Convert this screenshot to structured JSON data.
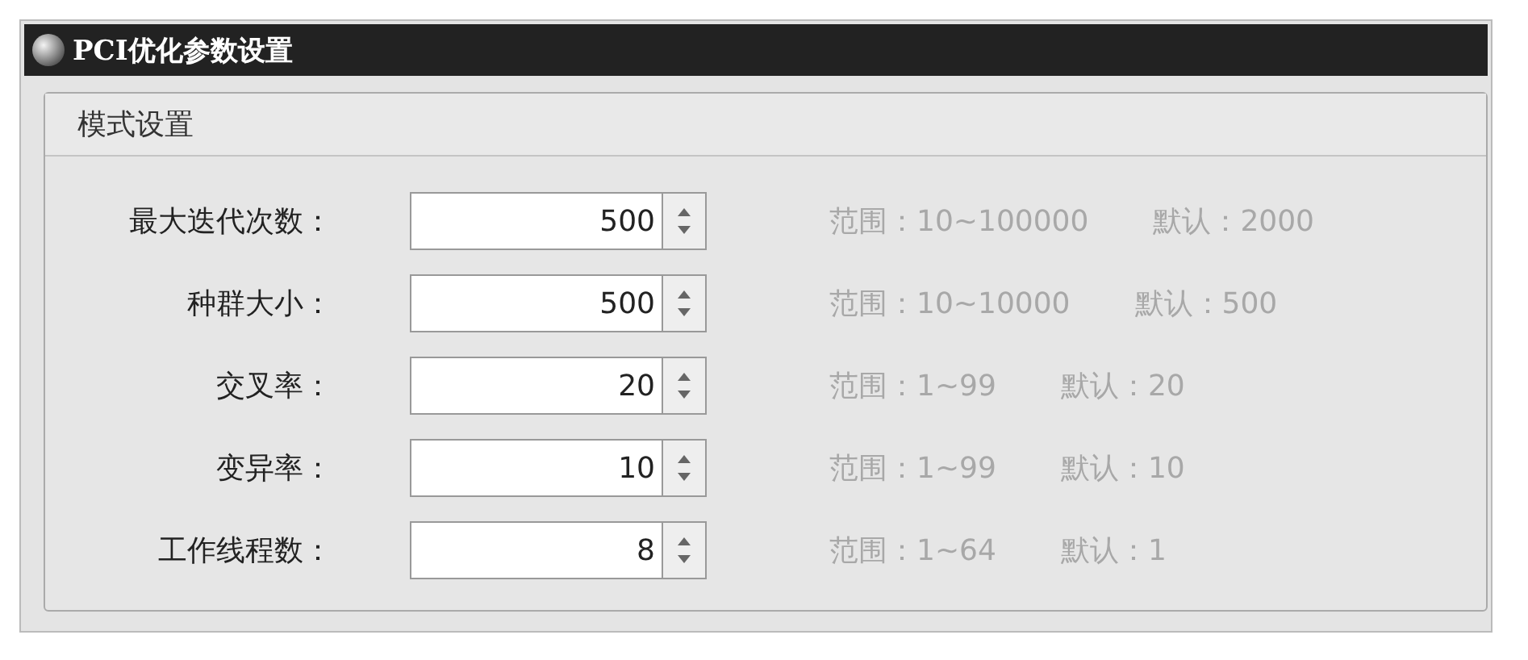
{
  "window": {
    "title": "PCI优化参数设置"
  },
  "group": {
    "title": "模式设置"
  },
  "fields": [
    {
      "label": "最大迭代次数：",
      "value": "500",
      "range": "范围：10~100000",
      "default": "默认：2000"
    },
    {
      "label": "种群大小：",
      "value": "500",
      "range": "范围：10~10000",
      "default": "默认：500"
    },
    {
      "label": "交叉率：",
      "value": "20",
      "range": "范围：1~99",
      "default": "默认：20"
    },
    {
      "label": "变异率：",
      "value": "10",
      "range": "范围：1~99",
      "default": "默认：10"
    },
    {
      "label": "工作线程数：",
      "value": "8",
      "range": "范围：1~64",
      "default": "默认：1"
    }
  ]
}
